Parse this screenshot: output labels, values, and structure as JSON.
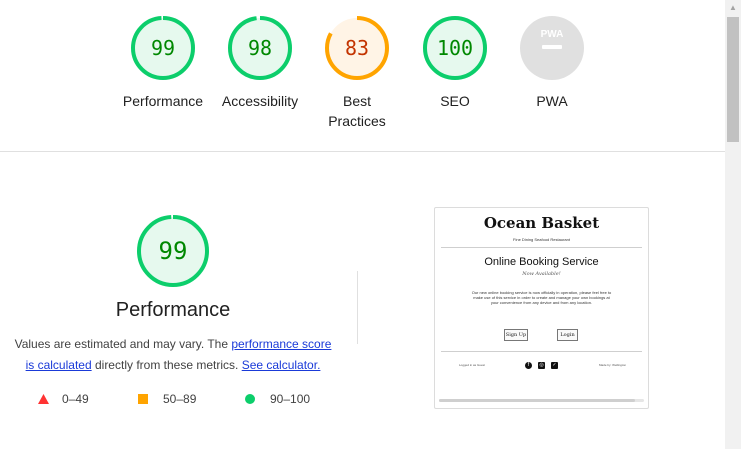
{
  "colors": {
    "pass": "#0cce6b",
    "pass_fill": "#e6f9ee",
    "pass_text": "#008800",
    "average": "#ffa400",
    "average_fill": "#fff4e6",
    "average_text": "#c33300",
    "fail": "#ff3333",
    "neutral": "#e0e0e0",
    "link": "#1a3ad8"
  },
  "categories": [
    {
      "score": "99",
      "label": "Performance",
      "fraction": 0.99,
      "rating": "pass"
    },
    {
      "score": "98",
      "label": "Accessibility",
      "fraction": 0.98,
      "rating": "pass"
    },
    {
      "score": "83",
      "label": "Best\nPractices",
      "fraction": 0.83,
      "rating": "average"
    },
    {
      "score": "100",
      "label": "SEO",
      "fraction": 1.0,
      "rating": "pass"
    },
    {
      "score": "",
      "label": "PWA",
      "fraction": 0,
      "rating": "pwa",
      "badge_text": "PWA"
    }
  ],
  "performance": {
    "score": "99",
    "fraction": 0.99,
    "title": "Performance",
    "desc_prefix": "Values are estimated and may vary. The ",
    "link_score": "performance score is calculated",
    "desc_middle": " directly from these metrics. ",
    "link_calc": "See calculator."
  },
  "legend": [
    {
      "range": "0–49",
      "icon": "triangle-icon"
    },
    {
      "range": "50–89",
      "icon": "square-icon"
    },
    {
      "range": "90–100",
      "icon": "circle-icon"
    }
  ],
  "screenshot": {
    "brand": "Ocean Basket",
    "subtitle": "Fine Dining Seafood Restaurant",
    "title": "Online Booking Service",
    "available": "Now Available!",
    "paragraph": "Our new online booking service is now officially in operation, please feel free to make use of this service in order to create and manage your own bookings at your convenience from any device and from any location.",
    "signup": "Sign Up",
    "login": "Login",
    "footer_left": "Logged in as Guest",
    "footer_right": "Made by: Wellington"
  }
}
